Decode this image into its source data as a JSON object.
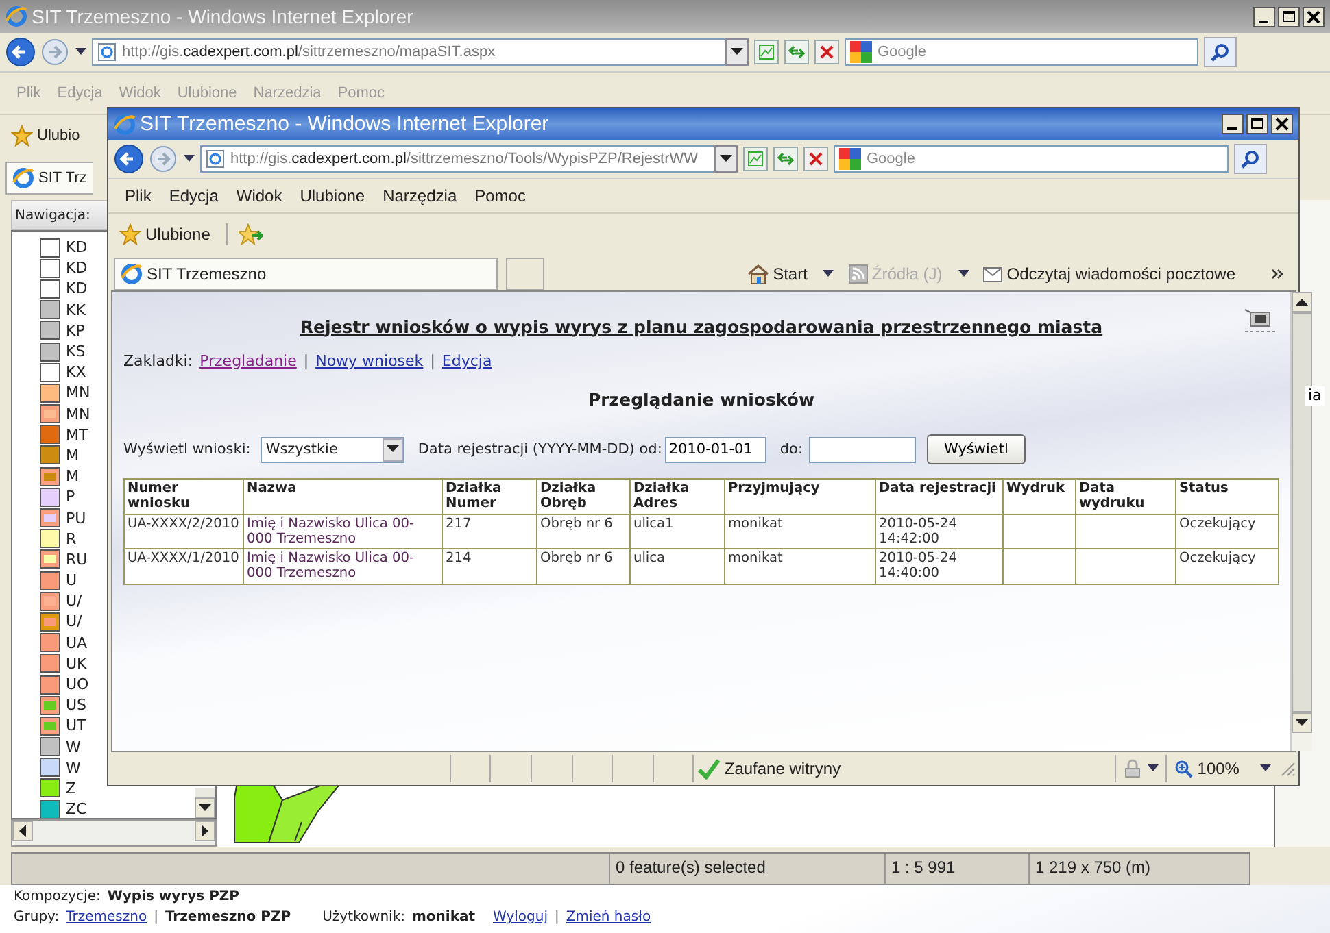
{
  "main_window": {
    "title": "SIT Trzemeszno - Windows Internet Explorer",
    "address": {
      "prefix": "http://gis.",
      "domain": "cadexpert.com.pl",
      "path": "/sittrzemeszno/mapaSIT.aspx"
    },
    "search_placeholder": "Google",
    "menu": [
      "Plik",
      "Edycja",
      "Widok",
      "Ulubione",
      "Narzedzia",
      "Pomoc"
    ],
    "favorites_label": "Ulubio",
    "tab": "SIT Trz",
    "navigation_label": "Nawigacja:",
    "legend": [
      {
        "code": "KD",
        "color": "#ffffff"
      },
      {
        "code": "KD",
        "color": "#ffffff"
      },
      {
        "code": "KD",
        "color": "#ffffff"
      },
      {
        "code": "KK",
        "color": "#c0c0c0"
      },
      {
        "code": "KP",
        "color": "#c0c0c0"
      },
      {
        "code": "KS",
        "color": "#c0c0c0"
      },
      {
        "code": "KX",
        "color": "#ffffff"
      },
      {
        "code": "MN",
        "color": "#fdbb80"
      },
      {
        "code": "MN",
        "color": "#f9a080",
        "inner": {
          "color": "#fdbb90"
        }
      },
      {
        "code": "MT",
        "color": "#e06a10"
      },
      {
        "code": "M",
        "color": "#cc8c10"
      },
      {
        "code": "M",
        "color": "#f9a080",
        "inner": {
          "color": "#cc8c10"
        }
      },
      {
        "code": "P",
        "color": "#e4d0fa"
      },
      {
        "code": "PU",
        "color": "#f9a080",
        "inner": {
          "color": "#e4d0fa"
        }
      },
      {
        "code": "R",
        "color": "#fffaaa"
      },
      {
        "code": "RU",
        "color": "#f9a080",
        "inner": {
          "color": "#fffaaa"
        }
      },
      {
        "code": "U",
        "color": "#f99a78"
      },
      {
        "code": "U/",
        "color": "#f9a080",
        "inner": {
          "color": "#fbb090"
        }
      },
      {
        "code": "U/",
        "color": "#e09a10",
        "inner": {
          "color": "#f99a78"
        }
      },
      {
        "code": "UA",
        "color": "#f99a78"
      },
      {
        "code": "UK",
        "color": "#f99a78"
      },
      {
        "code": "UO",
        "color": "#f99a78"
      },
      {
        "code": "US",
        "color": "#f9a080",
        "inner": {
          "color": "#66cc22"
        }
      },
      {
        "code": "UT",
        "color": "#f9a080",
        "inner": {
          "color": "#66cc22"
        }
      },
      {
        "code": "W",
        "color": "#c0c0c0"
      },
      {
        "code": "W",
        "color": "#c8daf8"
      },
      {
        "code": "Z",
        "color": "#88ee11"
      },
      {
        "code": "ZC",
        "color": "#10bbbb"
      }
    ],
    "side_text": "ia",
    "status_bar": [
      "0 feature(s) selected",
      "1 : 5 991",
      "1 219 x 750 (m)"
    ]
  },
  "footer": {
    "compositions_label": "Kompozycje:",
    "composition": "Wypis wyrys PZP",
    "groups_label": "Grupy:",
    "groups": [
      {
        "label": "Trzemeszno",
        "selected": false
      },
      {
        "label": "Trzemeszno PZP",
        "selected": true
      }
    ],
    "user_label": "Użytkownik:",
    "user": "monikat",
    "links": [
      "Wyloguj",
      "Zmień hasło"
    ],
    "separators": [
      "|",
      "|"
    ]
  },
  "popup_window": {
    "title": "SIT Trzemeszno - Windows Internet Explorer",
    "address": {
      "prefix": "http://gis.",
      "domain": "cadexpert.com.pl",
      "path": "/sittrzemeszno/Tools/WypisPZP/RejestrWW"
    },
    "search_placeholder": "Google",
    "menu": [
      "Plik",
      "Edycja",
      "Widok",
      "Ulubione",
      "Narzędzia",
      "Pomoc"
    ],
    "favorites_label": "Ulubione",
    "tab": "SIT Trzemeszno",
    "commands": [
      {
        "label": "Start",
        "kind": "home",
        "disabled": false
      },
      {
        "label": "Źródła (J)",
        "kind": "feed",
        "disabled": true
      },
      {
        "label": "Odczytaj wiadomości pocztowe",
        "kind": "mail",
        "disabled": false
      }
    ],
    "status_zone": "Zaufane witryny",
    "zoom": "100%",
    "page": {
      "heading": "Rejestr wniosków o wypis wyrys z planu zagospodarowania przestrzennego miasta",
      "tabs_label": "Zakladki:",
      "tabs": [
        {
          "label": "Przegladanie",
          "selected": true
        },
        {
          "label": "Nowy wniosek",
          "selected": false
        },
        {
          "label": "Edycja",
          "selected": false
        }
      ],
      "tab_separators": [
        "|",
        "|"
      ],
      "section_title": "Przeglądanie wniosków",
      "filter": {
        "show_label": "Wyświetl wnioski:",
        "show_value": "Wszystkie",
        "date_label": "Data rejestracji (YYYY-MM-DD) od:",
        "date_from": "2010-01-01",
        "to_label": "do:",
        "button": "Wyświetl"
      },
      "table": {
        "columns": [
          "Numer wniosku",
          "Nazwa",
          "Działka Numer",
          "Działka Obręb",
          "Działka Adres",
          "Przyjmujący",
          "Data rejestracji",
          "Wydruk",
          "Data wydruku",
          "Status"
        ],
        "rows": [
          [
            "UA-XXXX/2/2010",
            "Imię i Nazwisko Ulica 00-000 Trzemeszno",
            "217",
            "Obręb nr 6",
            "ulica1",
            "monikat",
            "2010-05-24 14:42:00",
            "",
            "",
            "Oczekujący"
          ],
          [
            "UA-XXXX/1/2010",
            "Imię i Nazwisko Ulica 00-000 Trzemeszno",
            "214",
            "Obręb nr 6",
            "ulica",
            "monikat",
            "2010-05-24 14:40:00",
            "",
            "",
            "Oczekujący"
          ]
        ]
      }
    }
  }
}
